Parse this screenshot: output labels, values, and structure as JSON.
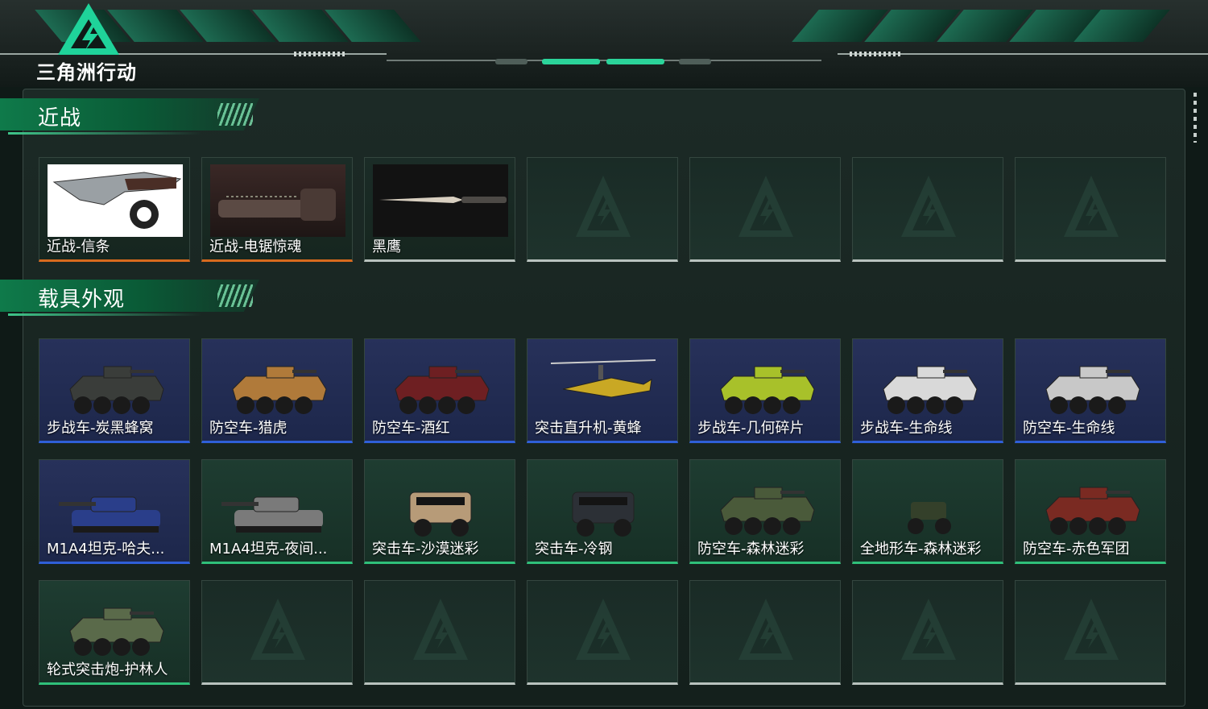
{
  "app": {
    "logo_text": "三角洲行动"
  },
  "sections": [
    {
      "title": "近战",
      "items": [
        {
          "name": "近战-信条",
          "rarity": "orange"
        },
        {
          "name": "近战-电锯惊魂",
          "rarity": "orange"
        },
        {
          "name": "黑鹰",
          "rarity": "white"
        },
        {
          "name": "",
          "rarity": "empty"
        },
        {
          "name": "",
          "rarity": "empty"
        },
        {
          "name": "",
          "rarity": "empty"
        },
        {
          "name": "",
          "rarity": "empty"
        }
      ]
    },
    {
      "title": "载具外观",
      "items": [
        {
          "name": "步战车-炭黑蜂窝",
          "rarity": "blue"
        },
        {
          "name": "防空车-猎虎",
          "rarity": "blue"
        },
        {
          "name": "防空车-酒红",
          "rarity": "blue"
        },
        {
          "name": "突击直升机-黄蜂",
          "rarity": "blue"
        },
        {
          "name": "步战车-几何碎片",
          "rarity": "blue"
        },
        {
          "name": "步战车-生命线",
          "rarity": "blue"
        },
        {
          "name": "防空车-生命线",
          "rarity": "blue"
        },
        {
          "name": "M1A4坦克-哈夫...",
          "rarity": "blue"
        },
        {
          "name": "M1A4坦克-夜间...",
          "rarity": "green"
        },
        {
          "name": "突击车-沙漠迷彩",
          "rarity": "green"
        },
        {
          "name": "突击车-冷钢",
          "rarity": "green"
        },
        {
          "name": "防空车-森林迷彩",
          "rarity": "green"
        },
        {
          "name": "全地形车-森林迷彩",
          "rarity": "green"
        },
        {
          "name": "防空车-赤色军团",
          "rarity": "green"
        },
        {
          "name": "轮式突击炮-护林人",
          "rarity": "green"
        },
        {
          "name": "",
          "rarity": "empty"
        },
        {
          "name": "",
          "rarity": "empty"
        },
        {
          "name": "",
          "rarity": "empty"
        },
        {
          "name": "",
          "rarity": "empty"
        },
        {
          "name": "",
          "rarity": "empty"
        },
        {
          "name": "",
          "rarity": "empty"
        }
      ]
    }
  ],
  "colors": {
    "orange": "#d86a1e",
    "blue": "#2f5fd8",
    "green": "#2fc07a",
    "accent": "#0f7a4a"
  }
}
